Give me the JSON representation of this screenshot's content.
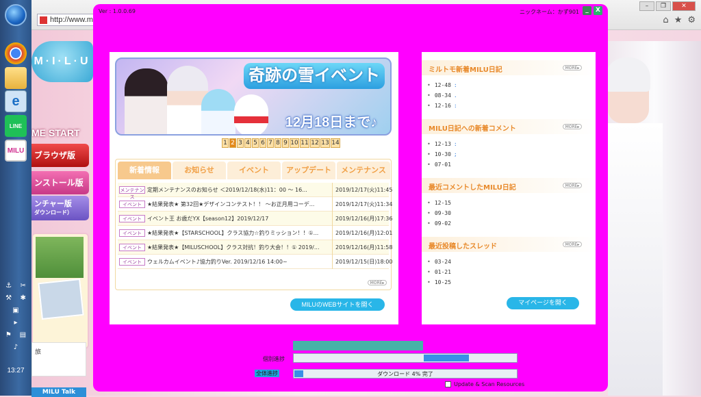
{
  "browser": {
    "address": "http://www.m",
    "win_buttons": [
      "–",
      "❐",
      "✕"
    ],
    "nav_icons": [
      "⌂",
      "★",
      "⚙"
    ]
  },
  "taskbar": {
    "icons": [
      "Chrome",
      "Explorer",
      "e",
      "LINE",
      "MILU"
    ],
    "clock": "13:27"
  },
  "site": {
    "logo": "M·I·L·U",
    "game_start": "ME START",
    "btn_browser": "ブラウザ版",
    "btn_install": "ンストール版",
    "btn_launcher": "ンチャー版",
    "btn_launcher_sub": "ダウンロード）",
    "side_text": "旅",
    "milu_talk": "MILU Talk"
  },
  "launcher": {
    "version": "Ver : 1.0.0.69",
    "nickname": "ニックネーム：かず901",
    "min_label": "_",
    "close_label": "X",
    "banner": {
      "title": "奇跡の雪イベント",
      "date": "12月18日まで♪"
    },
    "pager": [
      "1",
      "2",
      "3",
      "4",
      "5",
      "6",
      "7",
      "8",
      "9",
      "10",
      "11",
      "12",
      "13",
      "14"
    ],
    "pager_active": 2,
    "tabs": [
      "新着情報",
      "お知らせ",
      "イベント",
      "アップデート",
      "メンテナンス"
    ],
    "news": [
      {
        "cat": "メンテナンス",
        "title": "定期メンテナンスのお知らせ ＜2019/12/18(水)11：00 ～ 16...",
        "date": "2019/12/17(火)11:45"
      },
      {
        "cat": "イベント",
        "title": "★結果発表★ 第32回★デザインコンテスト！！ ～お正月用コーデ...",
        "date": "2019/12/17(火)11:34"
      },
      {
        "cat": "イベント",
        "title": "イベント王 お歳だYX【season12】2019/12/17",
        "date": "2019/12/16(月)17:36"
      },
      {
        "cat": "イベント",
        "title": "★結果発表★【STARSCHOOL】クラス協力☆釣りミッション！！①...",
        "date": "2019/12/16(月)12:01"
      },
      {
        "cat": "イベント",
        "title": "★結果発表★【MILUSCHOOL】クラス対抗！釣り大会！！① 2019/...",
        "date": "2019/12/16(月)11:58"
      },
      {
        "cat": "イベント",
        "title": "ウェルカムイベント♪協力釣りVer. 2019/12/16 14:00~",
        "date": "2019/12/15(日)18:00"
      }
    ],
    "more": "MORE▸",
    "btn_web": "MILUのWEBサイトを開く",
    "sections": [
      {
        "title": "ミルトモ新着MILU日記",
        "items": [
          {
            "t": "12-48",
            "x": ":"
          },
          {
            "t": "08-34",
            "x": "."
          },
          {
            "t": "12-16",
            "x": ":"
          }
        ]
      },
      {
        "title": "MILU日記への新着コメント",
        "items": [
          {
            "t": "12-13",
            "x": ":"
          },
          {
            "t": "10-30",
            "x": ";"
          },
          {
            "t": "07-01",
            "x": ""
          }
        ]
      },
      {
        "title": "最近コメントしたMILU日記",
        "items": [
          {
            "t": "12-15",
            "x": ""
          },
          {
            "t": "09-30",
            "x": ""
          },
          {
            "t": "09-02",
            "x": ""
          }
        ]
      },
      {
        "title": "最近投稿したスレッド",
        "items": [
          {
            "t": "03-24",
            "x": ""
          },
          {
            "t": "01-21",
            "x": ""
          },
          {
            "t": "10-25",
            "x": ""
          }
        ]
      }
    ],
    "btn_mypage": "マイページを開く",
    "file_label": "個別進捗",
    "total_label": "全体進捗",
    "total_text": "ダウンロード 4% 完了",
    "total_percent": 4,
    "checkbox_label": "Update & Scan Resources",
    "colors": {
      "window": "#ff00ff",
      "accent": "#29b6e8",
      "orange": "#e8892a"
    }
  }
}
